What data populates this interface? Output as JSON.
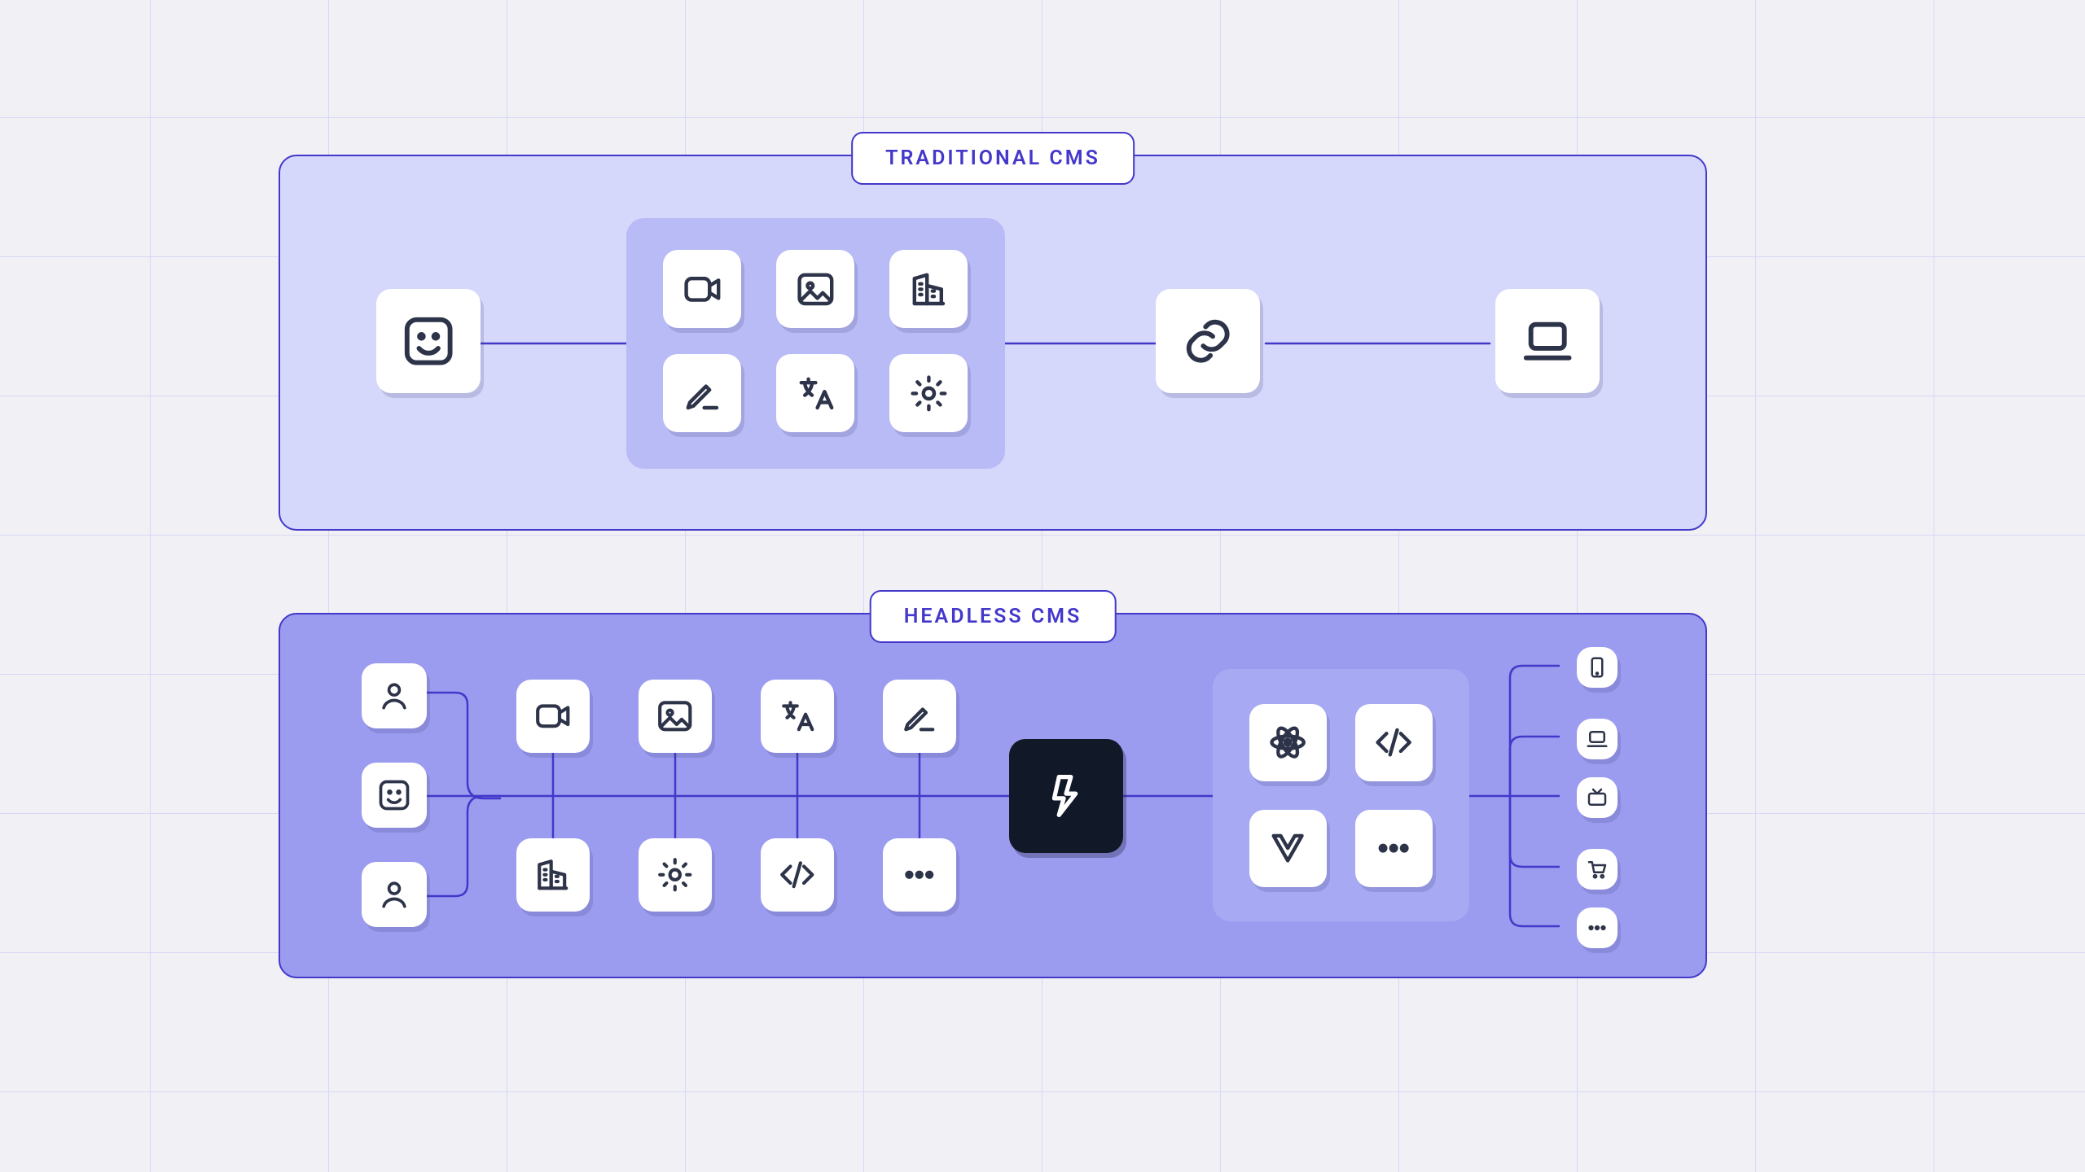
{
  "labels": {
    "traditional": "TRADITIONAL CMS",
    "headless": "HEADLESS CMS"
  },
  "colors": {
    "border": "#4338CA",
    "panel_light": "#D5D7FB",
    "panel_dark": "#9B9CEF",
    "group_light": "#B9BBF6",
    "group_dark": "#A7A9F2",
    "card": "#FFFFFF",
    "brand_box": "#111827",
    "icon_stroke": "#2D3348",
    "background": "#F0F0F5"
  },
  "traditional": {
    "user": "smiley-icon",
    "content_group": [
      "video-icon",
      "image-icon",
      "building-icon",
      "edit-icon",
      "translate-icon",
      "gear-icon"
    ],
    "link": "link-icon",
    "output": "laptop-icon"
  },
  "headless": {
    "users": [
      "person-icon",
      "smiley-icon",
      "person-icon"
    ],
    "content_row1": [
      "video-icon",
      "image-icon",
      "translate-icon",
      "edit-icon"
    ],
    "content_row2": [
      "building-icon",
      "gear-icon",
      "code-icon",
      "more-icon"
    ],
    "hub": "brand-logo",
    "frameworks": [
      "atom-icon",
      "code-icon",
      "vue-icon",
      "more-icon"
    ],
    "outputs": [
      "mobile-icon",
      "laptop-icon",
      "tv-icon",
      "cart-icon",
      "more-icon"
    ]
  }
}
